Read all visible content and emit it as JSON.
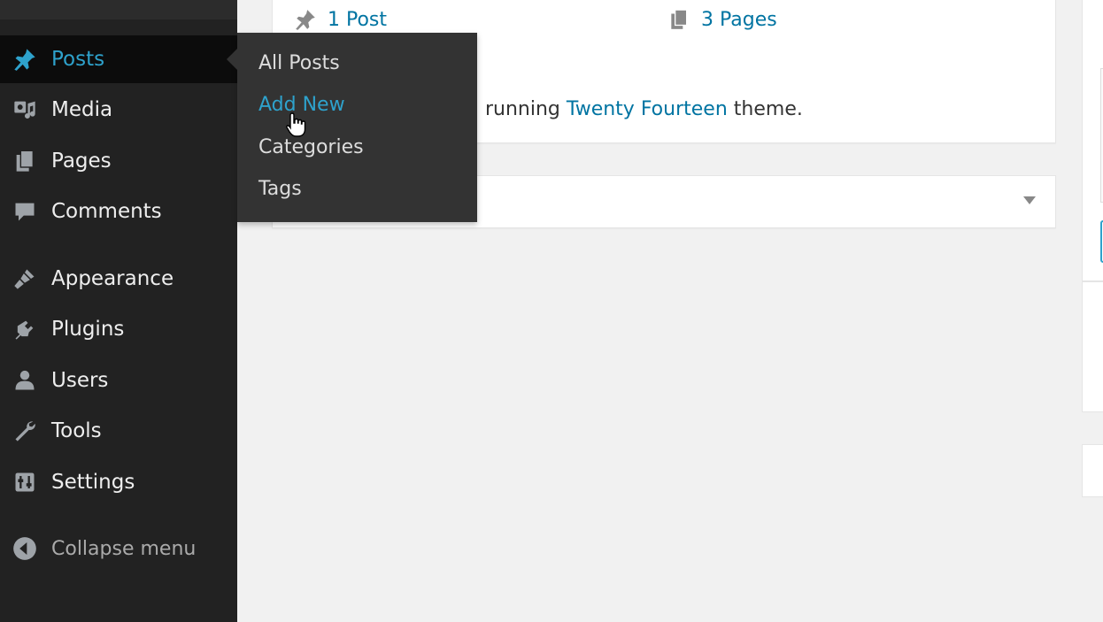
{
  "sidebar": {
    "items": [
      {
        "label": "Posts",
        "icon": "pushpin-icon"
      },
      {
        "label": "Media",
        "icon": "media-icon"
      },
      {
        "label": "Pages",
        "icon": "pages-icon"
      },
      {
        "label": "Comments",
        "icon": "comment-icon"
      },
      {
        "label": "Appearance",
        "icon": "paintbrush-icon"
      },
      {
        "label": "Plugins",
        "icon": "plug-icon"
      },
      {
        "label": "Users",
        "icon": "user-icon"
      },
      {
        "label": "Tools",
        "icon": "wrench-icon"
      },
      {
        "label": "Settings",
        "icon": "settings-icon"
      }
    ],
    "collapse_label": "Collapse menu",
    "active_color": "#2ea2cc"
  },
  "flyout": {
    "items": [
      "All Posts",
      "Add New",
      "Categories",
      "Tags"
    ],
    "hovered": "Add New"
  },
  "glance": {
    "posts_link": "1 Post",
    "pages_link": "3 Pages",
    "theme_prefix": "running",
    "theme_name": "Twenty Fourteen",
    "theme_suffix": "theme."
  },
  "colors": {
    "sidebar_bg": "#222222",
    "link": "#0074a2",
    "content_bg": "#f1f1f1"
  }
}
